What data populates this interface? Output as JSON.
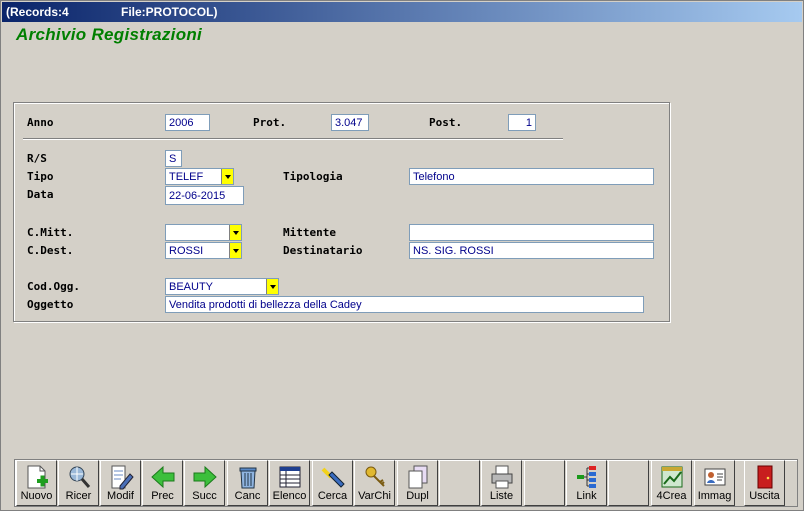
{
  "titlebar": {
    "records": "(Records:4",
    "file": "File:PROTOCOL)"
  },
  "app_title": "Archivio Registrazioni",
  "form": {
    "anno": {
      "label": "Anno",
      "value": "2006"
    },
    "prot": {
      "label": "Prot.",
      "value": "3.047"
    },
    "post": {
      "label": "Post.",
      "value": "1"
    },
    "rs": {
      "label": "R/S",
      "value": "S"
    },
    "tipo": {
      "label": "Tipo",
      "value": "TELEF"
    },
    "tipologia": {
      "label": "Tipologia",
      "value": "Telefono"
    },
    "data": {
      "label": "Data",
      "value": "22-06-2015"
    },
    "cmitt": {
      "label": "C.Mitt.",
      "value": ""
    },
    "mittente": {
      "label": "Mittente",
      "value": ""
    },
    "cdest": {
      "label": "C.Dest.",
      "value": "ROSSI"
    },
    "destinatario": {
      "label": "Destinatario",
      "value": "NS. SIG. ROSSI"
    },
    "codogg": {
      "label": "Cod.Ogg.",
      "value": "BEAUTY"
    },
    "oggetto": {
      "label": "Oggetto",
      "value": "Vendita prodotti di bellezza della Cadey"
    }
  },
  "toolbar": {
    "nuovo": "Nuovo",
    "ricer": "Ricer",
    "modif": "Modif",
    "prec": "Prec",
    "succ": "Succ",
    "canc": "Canc",
    "elenco": "Elenco",
    "cerca": "Cerca",
    "varchi": "VarChi",
    "dupl": "Dupl",
    "liste": "Liste",
    "link": "Link",
    "crea4": "4Crea",
    "immag": "Immag",
    "uscita": "Uscita"
  },
  "icons": {
    "nuovo": "new-document-icon",
    "ricer": "search-globe-icon",
    "modif": "edit-document-icon",
    "prec": "arrow-left-icon",
    "succ": "arrow-right-icon",
    "canc": "trash-icon",
    "elenco": "list-table-icon",
    "cerca": "flashlight-icon",
    "varchi": "keys-icon",
    "dupl": "duplicate-icon",
    "liste": "printer-icon",
    "link": "link-tree-icon",
    "crea4": "create-chart-icon",
    "immag": "image-card-icon",
    "uscita": "exit-door-icon"
  },
  "colors": {
    "title_green": "#007f00",
    "field_text": "#00008b",
    "combo_arrow": "#ffff00"
  }
}
